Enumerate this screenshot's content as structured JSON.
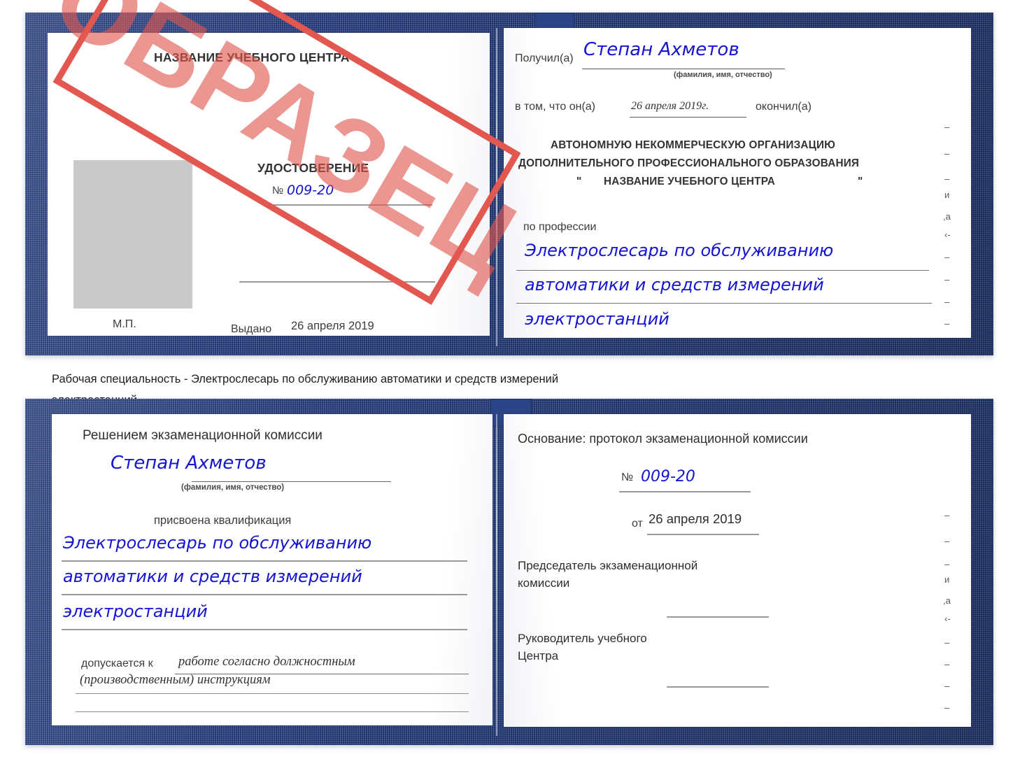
{
  "document": {
    "type": "Удостоверение",
    "watermark": "ОБРАЗЕЦ",
    "accent_blue": "#21397c",
    "ink_blue": "#1414d2",
    "stamp_red": "#e2574f",
    "paper": "#fdfdfd"
  },
  "caption": {
    "line1": "Рабочая специальность - Электрослесарь по обслуживанию автоматики и средств измерений",
    "line2": "электростанций"
  },
  "cert_top": {
    "left_page": {
      "center_name": "НАЗВАНИЕ УЧЕБНОГО ЦЕНТРА",
      "title": "УДОСТОВЕРЕНИЕ",
      "number_label": "№",
      "number_value": "009-20",
      "issued_label": "Выдано",
      "issued_value": "26 апреля 2019",
      "seal_label": "М.П."
    },
    "right_page": {
      "received_label": "Получил(а)",
      "received_value": "Степан Ахметов",
      "fio_hint": "(фамилия, имя, отчество)",
      "that_he_label": "в том, что он(а)",
      "finish_date": "26 апреля 2019г.",
      "finished_label": "окончил(а)",
      "org_line1": "АВТОНОМНУЮ НЕКОММЕРЧЕСКУЮ ОРГАНИЗАЦИЮ",
      "org_line2": "ДОПОЛНИТЕЛЬНОГО ПРОФЕССИОНАЛЬНОГО ОБРАЗОВАНИЯ",
      "org_quote_open": "\"",
      "org_line3": "НАЗВАНИЕ УЧЕБНОГО ЦЕНТРА",
      "org_quote_close": "\"",
      "profession_label": "по профессии",
      "profession_line1": "Электрослесарь по обслуживанию",
      "profession_line2": "автоматики и средств измерений",
      "profession_line3": "электростанций",
      "bleed_glyphs": [
        "–",
        "–",
        "–",
        "и",
        ",а",
        "‹-",
        "–",
        "–",
        "–",
        "–"
      ]
    }
  },
  "cert_bottom": {
    "left_page": {
      "decision_label": "Решением экзаменационной комиссии",
      "name_value": "Степан Ахметов",
      "fio_hint": "(фамилия, имя, отчество)",
      "qualification_label": "присвоена квалификация",
      "qualification_line1": "Электрослесарь по обслуживанию",
      "qualification_line2": "автоматики и средств измерений",
      "qualification_line3": "электростанций",
      "admitted_label": "допускается к",
      "admitted_value1": "работе согласно должностным",
      "admitted_value2": "(производственным) инструкциям"
    },
    "right_page": {
      "basis_label": "Основание: протокол экзаменационной комиссии",
      "number_label": "№",
      "number_value": "009-20",
      "from_label": "от",
      "from_value": "26 апреля 2019",
      "chairman_line1": "Председатель экзаменационной",
      "chairman_line2": "комиссии",
      "head_line1": "Руководитель учебного",
      "head_line2": "Центра",
      "bleed_glyphs": [
        "–",
        "–",
        "–",
        "и",
        ",а",
        "‹-",
        "–",
        "–",
        "–",
        "–"
      ]
    }
  }
}
